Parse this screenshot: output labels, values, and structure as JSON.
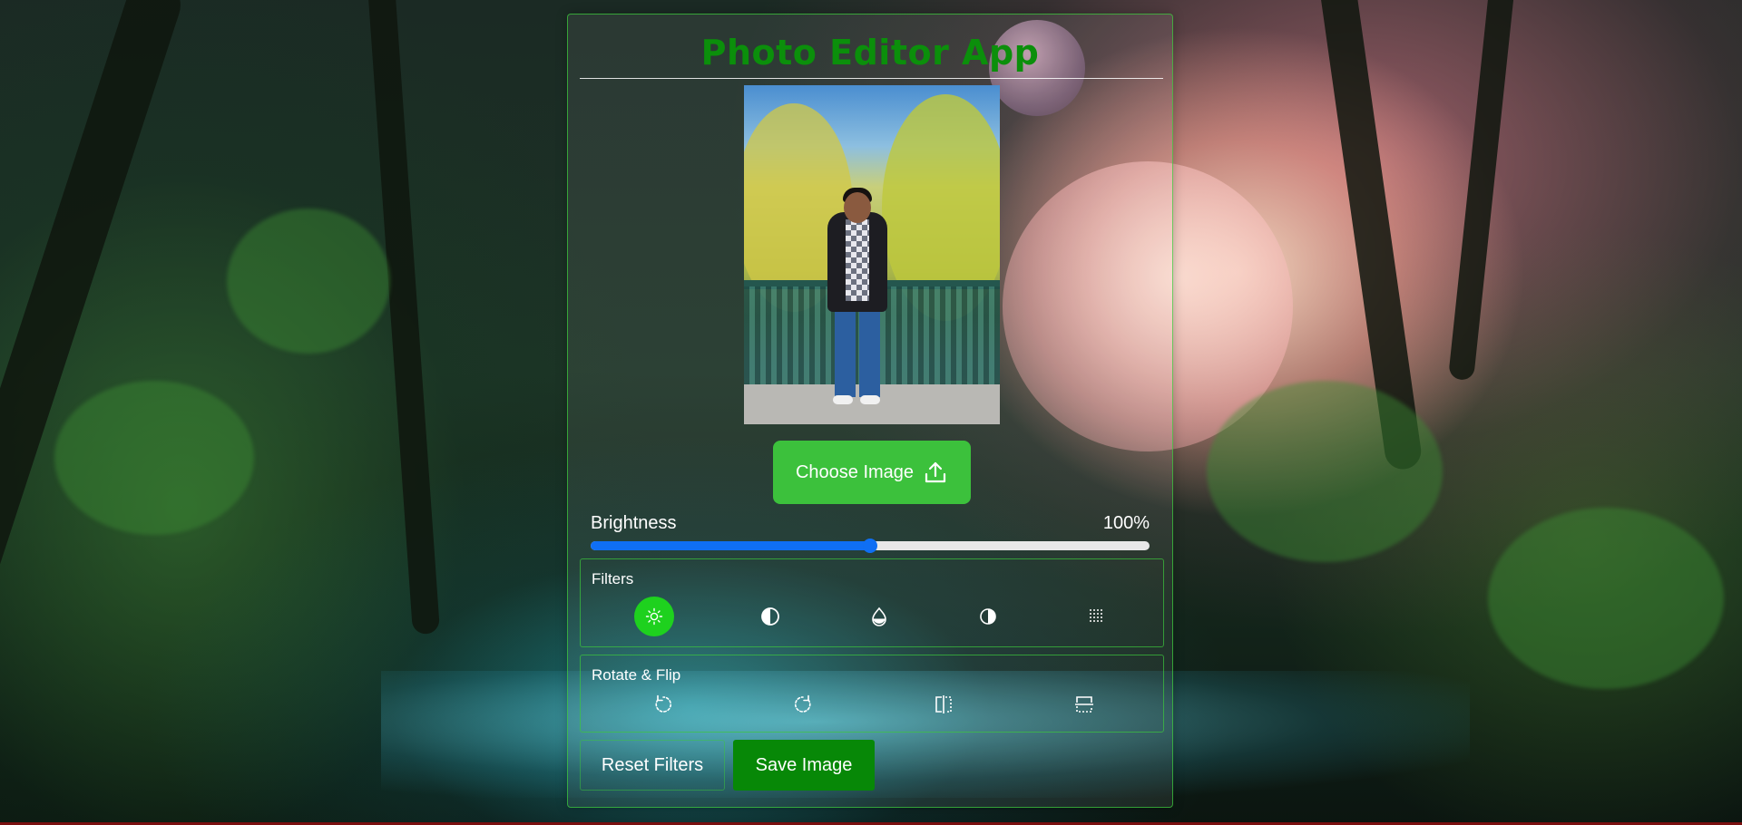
{
  "app": {
    "title": "Photo Editor App"
  },
  "image": {
    "alt": "Uploaded photo of a person standing by an ornate green railing with trees behind"
  },
  "choose_button": {
    "label": "Choose Image",
    "icon": "upload-icon"
  },
  "brightness": {
    "label": "Brightness",
    "value_text": "100%",
    "level_fraction": 0.5
  },
  "filters": {
    "title": "Filters",
    "items": [
      {
        "name": "brightness",
        "icon": "sun-icon",
        "active": true
      },
      {
        "name": "contrast",
        "icon": "half-circle-icon",
        "active": false
      },
      {
        "name": "saturation",
        "icon": "droplet-icon",
        "active": false
      },
      {
        "name": "grayscale",
        "icon": "contrast-icon",
        "active": false
      },
      {
        "name": "blur",
        "icon": "grid-dots-icon",
        "active": false
      }
    ]
  },
  "rotate_flip": {
    "title": "Rotate & Flip",
    "items": [
      {
        "name": "rotate-left",
        "icon": "rotate-left-icon"
      },
      {
        "name": "rotate-right",
        "icon": "rotate-right-icon"
      },
      {
        "name": "flip-horizontal",
        "icon": "flip-horizontal-icon"
      },
      {
        "name": "flip-vertical",
        "icon": "flip-vertical-icon"
      }
    ]
  },
  "actions": {
    "reset_label": "Reset Filters",
    "save_label": "Save Image"
  },
  "colors": {
    "accent": "#3cc13c",
    "title": "#0b8f0b",
    "slider": "#0f6ff4",
    "active_filter": "#1ed11e",
    "save": "#078807"
  }
}
